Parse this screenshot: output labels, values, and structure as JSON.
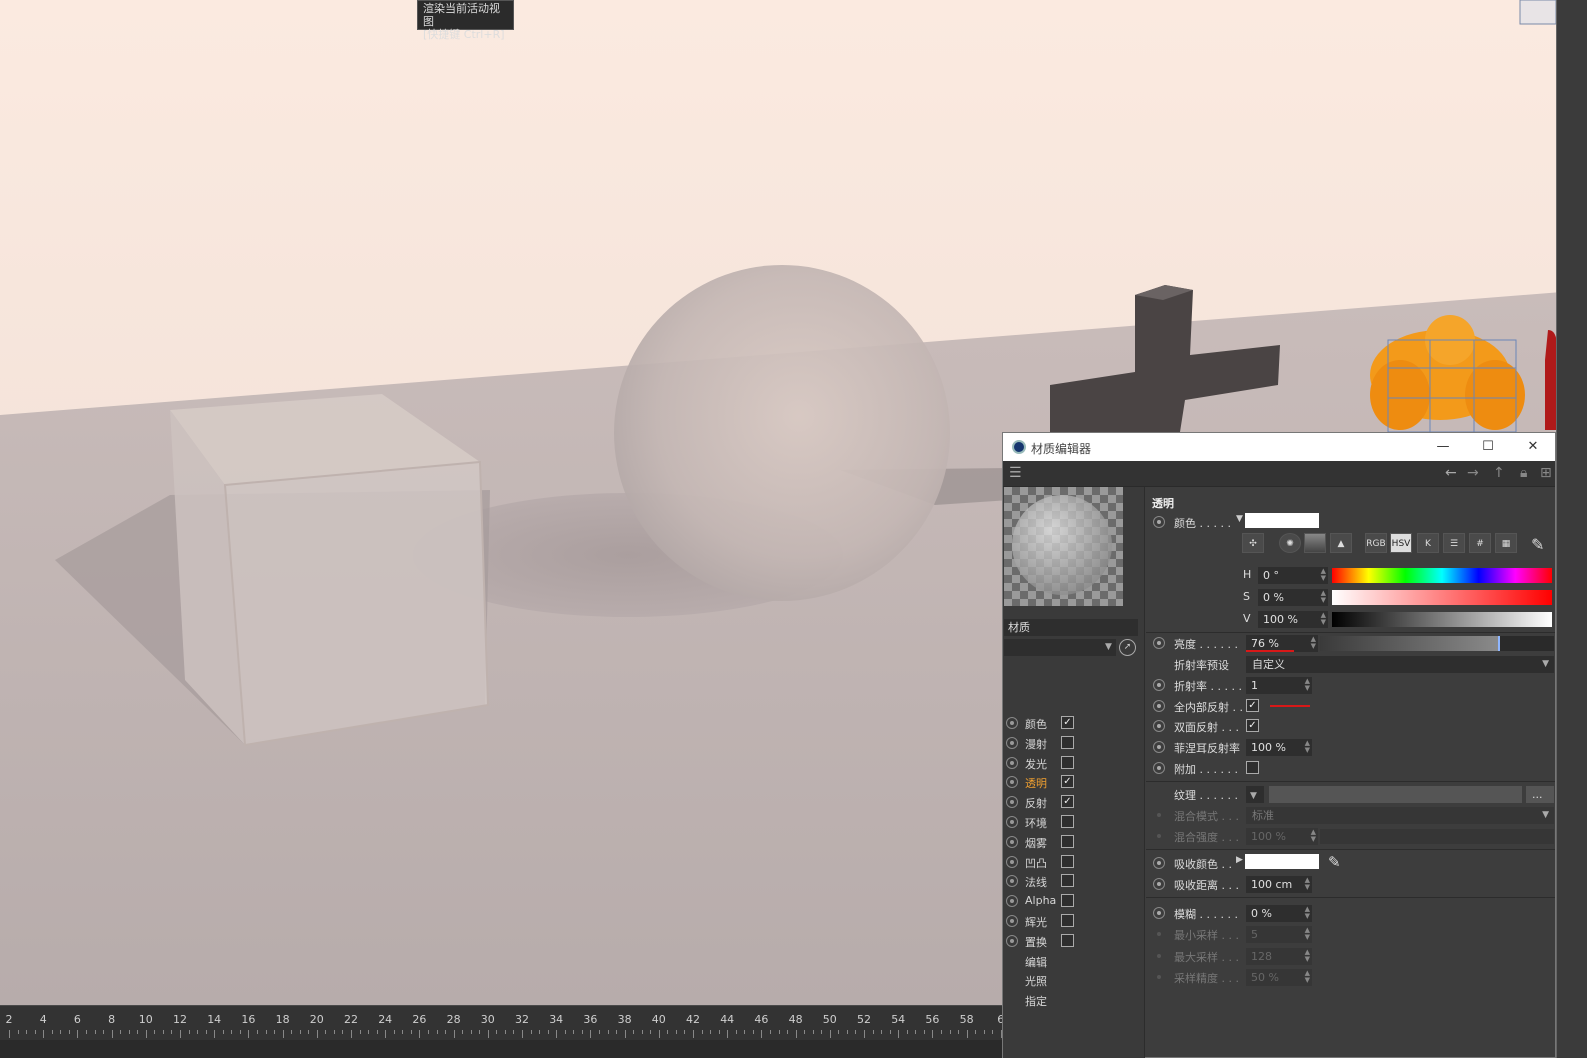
{
  "tooltip": {
    "line1": "渲染当前活动视图",
    "line2": "[快捷键 Ctrl+R]"
  },
  "timeline": {
    "ticks": [
      "2",
      "4",
      "6",
      "8",
      "10",
      "12",
      "14",
      "16",
      "18",
      "20",
      "22",
      "24",
      "26",
      "28",
      "30",
      "32",
      "34",
      "36",
      "38",
      "40",
      "42",
      "44",
      "46",
      "48",
      "50",
      "52",
      "54",
      "56",
      "58",
      "6"
    ]
  },
  "material_editor": {
    "title": "材质编辑器",
    "material_name": "材质",
    "channels": [
      {
        "label": "颜色",
        "checked": true,
        "has_checkbox": true
      },
      {
        "label": "漫射",
        "checked": false,
        "has_checkbox": true
      },
      {
        "label": "发光",
        "checked": false,
        "has_checkbox": true
      },
      {
        "label": "透明",
        "checked": true,
        "has_checkbox": true,
        "active": true
      },
      {
        "label": "反射",
        "checked": true,
        "has_checkbox": true
      },
      {
        "label": "环境",
        "checked": false,
        "has_checkbox": true
      },
      {
        "label": "烟雾",
        "checked": false,
        "has_checkbox": true
      },
      {
        "label": "凹凸",
        "checked": false,
        "has_checkbox": true
      },
      {
        "label": "法线",
        "checked": false,
        "has_checkbox": true
      },
      {
        "label": "Alpha",
        "checked": false,
        "has_checkbox": true
      },
      {
        "label": "辉光",
        "checked": false,
        "has_checkbox": true
      },
      {
        "label": "置换",
        "checked": false,
        "has_checkbox": true
      },
      {
        "label": "编辑",
        "has_checkbox": false
      },
      {
        "label": "光照",
        "has_checkbox": false
      },
      {
        "label": "指定",
        "has_checkbox": false
      }
    ],
    "section_title": "透明",
    "color_label": "颜色 . . . . .",
    "color_modes": [
      "RGB",
      "HSV",
      "K"
    ],
    "hsv": {
      "h_label": "H",
      "h": "0 °",
      "s_label": "S",
      "s": "0 %",
      "v_label": "V",
      "v": "100 %"
    },
    "brightness": {
      "label": "亮度 . . . . . .",
      "value": "76 %",
      "level": 0.76
    },
    "ior_preset": {
      "label": "折射率预设",
      "value": "自定义"
    },
    "ior": {
      "label": "折射率 . . . . .",
      "value": "1"
    },
    "total_internal": {
      "label": "全内部反射 . .",
      "checked": true
    },
    "double_sided": {
      "label": "双面反射 . . .",
      "checked": true
    },
    "fresnel": {
      "label": "菲涅耳反射率",
      "value": "100 %"
    },
    "additive": {
      "label": "附加 . . . . . .",
      "checked": false
    },
    "texture": {
      "label": "纹理 . . . . . .",
      "button": "..."
    },
    "blend_mode": {
      "label": "混合模式 . . .",
      "value": "标准"
    },
    "blend_strength": {
      "label": "混合强度 . . .",
      "value": "100 %"
    },
    "absorb_color": {
      "label": "吸收颜色 . ."
    },
    "absorb_distance": {
      "label": "吸收距离 . . .",
      "value": "100 cm"
    },
    "blur": {
      "label": "模糊 . . . . . .",
      "value": "0 %"
    },
    "min_samples": {
      "label": "最小采样 . . .",
      "value": "5"
    },
    "max_samples": {
      "label": "最大采样 . . .",
      "value": "128"
    },
    "sample_accuracy": {
      "label": "采样精度 . . .",
      "value": "50 %"
    }
  }
}
